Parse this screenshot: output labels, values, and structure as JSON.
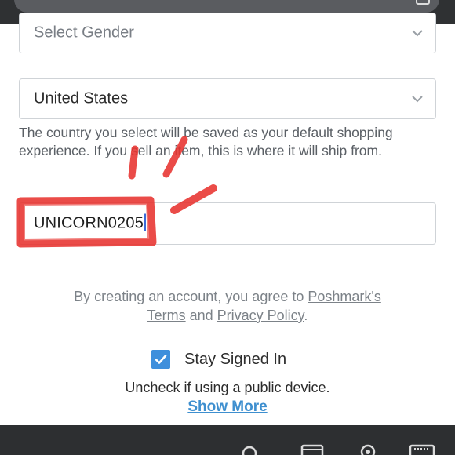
{
  "gender_select": {
    "placeholder": "Select Gender"
  },
  "country_select": {
    "value": "United States"
  },
  "country_helper": "The country you select will be saved as your default shopping experience. If you sell an item, this is where it will ship from.",
  "invite_code_field": {
    "value": "UNICORN0205"
  },
  "terms": {
    "prefix": "By creating an account, you agree to ",
    "brand_link": "Poshmark's",
    "terms_link": "Terms",
    "and": " and ",
    "privacy_link": "Privacy Policy",
    "suffix": "."
  },
  "stay_signed_in": {
    "label": "Stay Signed In",
    "checked": true
  },
  "public_device_hint": "Uncheck if using a public device.",
  "show_more": "Show More",
  "colors": {
    "accent": "#3e8fdc",
    "annotation": "#e8332f",
    "chrome": "#2f3133"
  },
  "icons": [
    "chevron-down-icon",
    "checkmark-icon",
    "search-icon",
    "card-icon",
    "location-pin-icon",
    "keyboard-icon"
  ]
}
